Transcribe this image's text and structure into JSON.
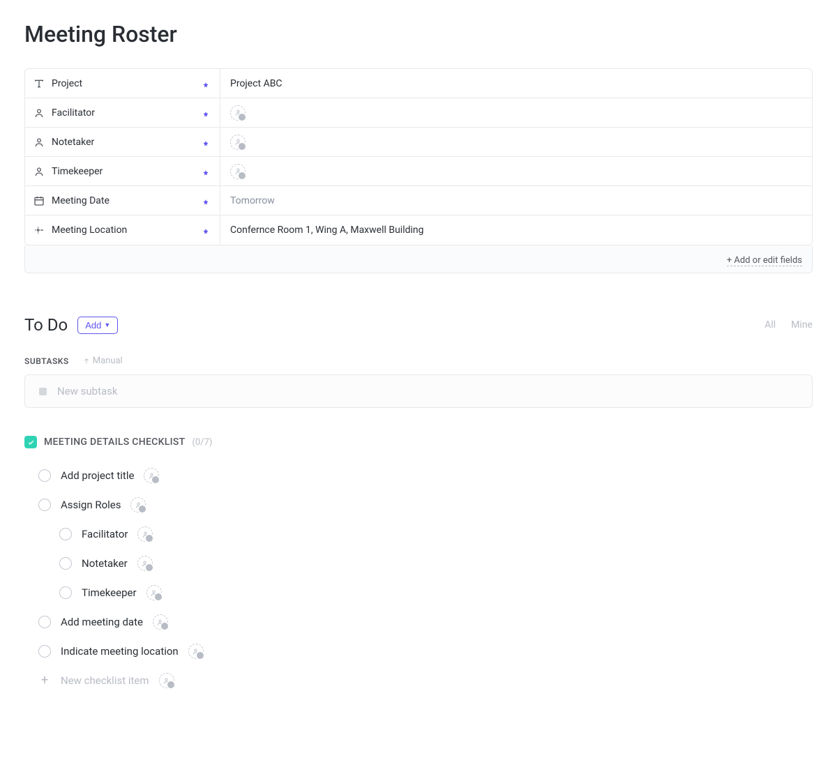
{
  "pageTitle": "Meeting Roster",
  "fields": [
    {
      "icon": "text",
      "label": "Project",
      "value": "Project ABC",
      "type": "text"
    },
    {
      "icon": "person",
      "label": "Facilitator",
      "value": "",
      "type": "user"
    },
    {
      "icon": "person",
      "label": "Notetaker",
      "value": "",
      "type": "user"
    },
    {
      "icon": "person",
      "label": "Timekeeper",
      "value": "",
      "type": "user"
    },
    {
      "icon": "calendar",
      "label": "Meeting Date",
      "value": "Tomorrow",
      "type": "text",
      "muted": true
    },
    {
      "icon": "location",
      "label": "Meeting Location",
      "value": "Confernce Room 1, Wing A, Maxwell Building",
      "type": "text"
    }
  ],
  "addFieldsLabel": "+ Add or edit fields",
  "todo": {
    "title": "To Do",
    "addLabel": "Add",
    "filters": [
      "All",
      "Mine"
    ]
  },
  "subtasks": {
    "headerLabel": "SUBTASKS",
    "sortLabel": "Manual",
    "newPlaceholder": "New subtask"
  },
  "checklist": {
    "title": "MEETING DETAILS CHECKLIST",
    "count": "(0/7)",
    "items": [
      {
        "label": "Add project title",
        "nested": false
      },
      {
        "label": "Assign Roles",
        "nested": false
      },
      {
        "label": "Facilitator",
        "nested": true
      },
      {
        "label": "Notetaker",
        "nested": true
      },
      {
        "label": "Timekeeper",
        "nested": true
      },
      {
        "label": "Add meeting date",
        "nested": false
      },
      {
        "label": "Indicate meeting location",
        "nested": false
      }
    ],
    "newPlaceholder": "New checklist item"
  }
}
